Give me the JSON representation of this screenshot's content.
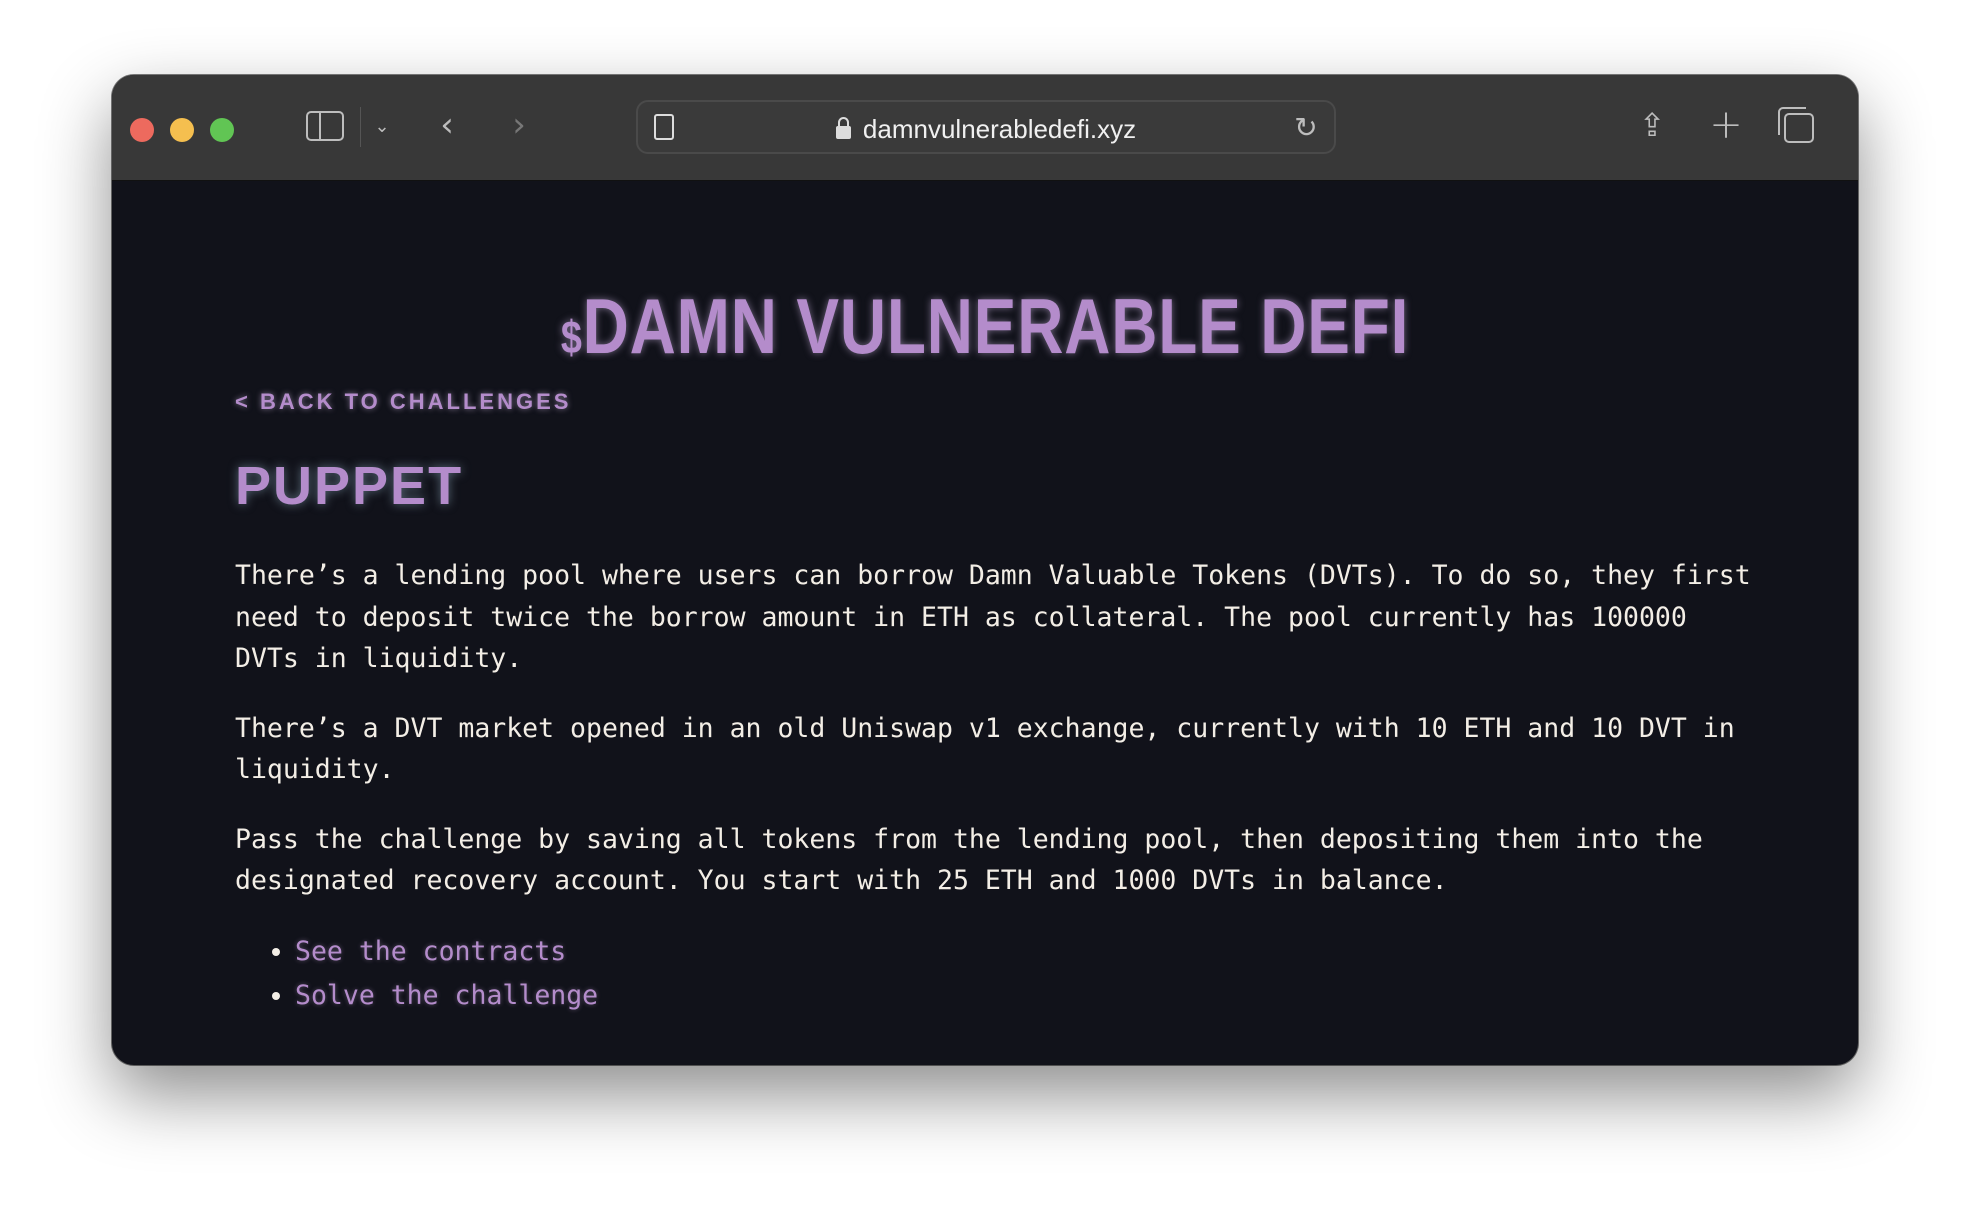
{
  "browser": {
    "url": "damnvulnerabledefi.xyz",
    "icons": [
      "sidebar-icon",
      "chevron-down-icon",
      "back-icon",
      "forward-icon",
      "reader-icon",
      "lock-icon",
      "reload-icon",
      "share-icon",
      "new-tab-icon",
      "tabs-overview-icon"
    ],
    "colors": {
      "close": "#ed6a5e",
      "minimize": "#f5bf4f",
      "zoom": "#61c554"
    }
  },
  "page": {
    "logo_dollar": "$",
    "logo": "DAMN VULNERABLE DEFI",
    "back_link": "< BACK TO CHALLENGES",
    "title": "PUPPET",
    "paragraphs": [
      "There’s a lending pool where users can borrow Damn Valuable Tokens (DVTs). To do so, they first need to deposit twice the borrow amount in ETH as collateral. The pool currently has 100000 DVTs in liquidity.",
      "There’s a DVT market opened in an old Uniswap v1 exchange, currently with 10 ETH and 10 DVT in liquidity.",
      "Pass the challenge by saving all tokens from the lending pool, then depositing them into the designated recovery account. You start with 25 ETH and 1000 DVTs in balance."
    ],
    "links": [
      "See the contracts",
      "Solve the challenge"
    ],
    "colors": {
      "accent": "#b48ccb",
      "background": "#11121a",
      "text": "#f3eee6"
    }
  }
}
